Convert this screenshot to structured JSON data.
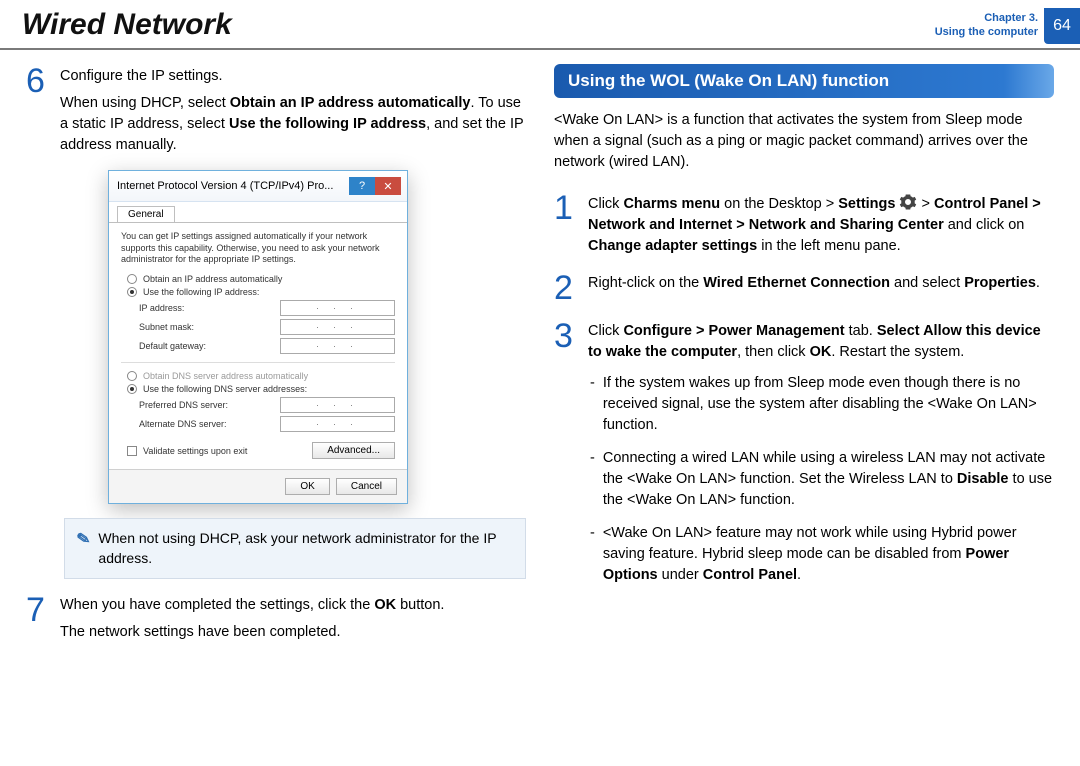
{
  "header": {
    "title": "Wired Network",
    "chapter_line1": "Chapter 3.",
    "chapter_line2": "Using the computer",
    "page_number": "64"
  },
  "left": {
    "step6": {
      "num": "6",
      "p1": "Configure the IP settings.",
      "p2_a": "When using DHCP, select ",
      "p2_b": "Obtain an IP address automatically",
      "p2_c": ". To use a static IP address, select ",
      "p2_d": "Use the following IP address",
      "p2_e": ", and set the IP address manually."
    },
    "dialog": {
      "title": "Internet Protocol Version 4 (TCP/IPv4) Pro...",
      "tab_general": "General",
      "text": "You can get IP settings assigned automatically if your network supports this capability. Otherwise, you need to ask your network administrator for the appropriate IP settings.",
      "opt_obtain_ip": "Obtain an IP address automatically",
      "opt_use_ip": "Use the following IP address:",
      "lbl_ip": "IP address:",
      "lbl_subnet": "Subnet mask:",
      "lbl_gateway": "Default gateway:",
      "opt_obtain_dns": "Obtain DNS server address automatically",
      "opt_use_dns": "Use the following DNS server addresses:",
      "lbl_pref_dns": "Preferred DNS server:",
      "lbl_alt_dns": "Alternate DNS server:",
      "chk_validate": "Validate settings upon exit",
      "btn_advanced": "Advanced...",
      "btn_ok": "OK",
      "btn_cancel": "Cancel",
      "dots": ".   .   ."
    },
    "note": "When not using DHCP, ask your network administrator for the IP address.",
    "step7": {
      "num": "7",
      "p1_a": "When you have completed the settings, click the ",
      "p1_b": "OK",
      "p1_c": " button.",
      "p2": "The network settings have been completed."
    }
  },
  "right": {
    "banner": "Using the WOL (Wake On LAN) function",
    "intro": "<Wake On LAN> is a function that activates the system from Sleep mode when a signal (such as a ping or magic packet command) arrives over the network (wired LAN).",
    "step1": {
      "num": "1",
      "a": "Click ",
      "b": "Charms menu",
      "c": " on the Desktop > ",
      "d": "Settings",
      "e": " > ",
      "f": "Control Panel > Network and Internet > Network and Sharing Center",
      "g": " and click on ",
      "h": "Change adapter settings",
      "i": " in the left menu pane."
    },
    "step2": {
      "num": "2",
      "a": "Right-click on the ",
      "b": "Wired Ethernet Connection",
      "c": " and select ",
      "d": "Properties",
      "e": "."
    },
    "step3": {
      "num": "3",
      "a": "Click ",
      "b": "Configure > Power Management",
      "c": " tab. ",
      "d": "Select Allow this device to wake the computer",
      "e": ", then click ",
      "f": "OK",
      "g": ". Restart the system."
    },
    "n1": "If the system wakes up from Sleep mode even though there is no received signal, use the system after disabling the <Wake On LAN> function.",
    "n2_a": "Connecting a wired LAN while using a wireless LAN may not activate the <Wake On LAN> function. Set the Wireless LAN to ",
    "n2_b": "Disable",
    "n2_c": " to use the <Wake On LAN> function.",
    "n3_a": "<Wake On LAN> feature may not work while using Hybrid power saving feature. Hybrid sleep mode can be disabled from ",
    "n3_b": "Power Options",
    "n3_c": " under ",
    "n3_d": "Control Panel",
    "n3_e": "."
  }
}
